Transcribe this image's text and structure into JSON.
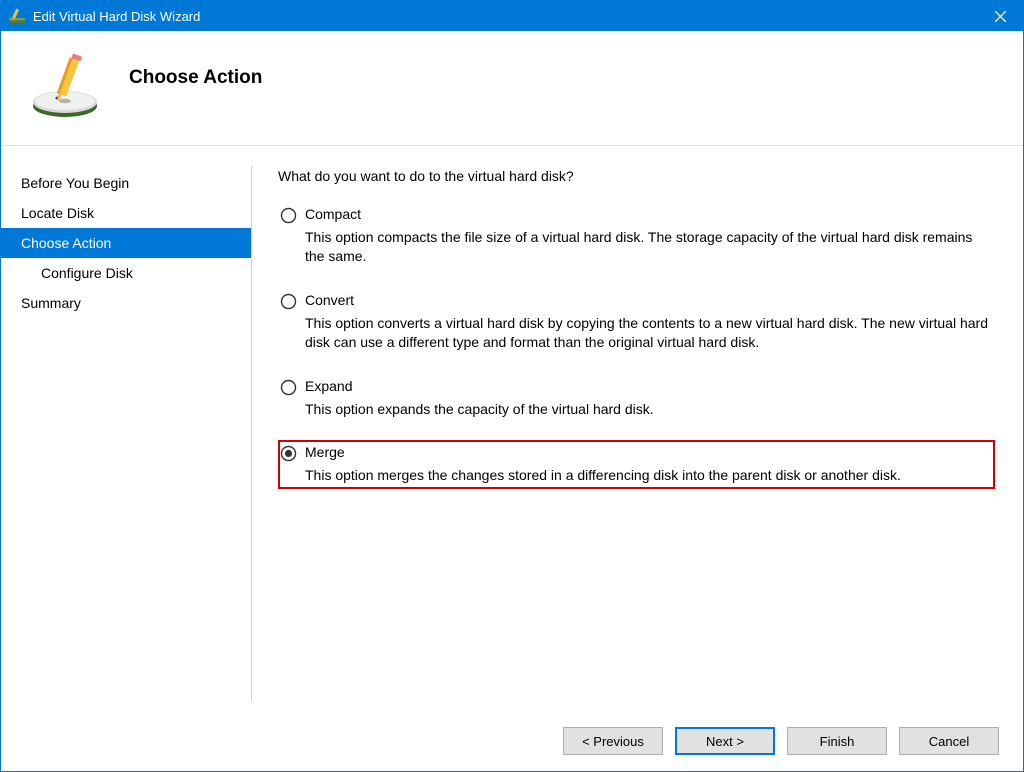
{
  "titlebar": {
    "title": "Edit Virtual Hard Disk Wizard"
  },
  "header": {
    "title": "Choose Action"
  },
  "sidebar": {
    "items": [
      {
        "label": "Before You Begin",
        "active": false,
        "child": false
      },
      {
        "label": "Locate Disk",
        "active": false,
        "child": false
      },
      {
        "label": "Choose Action",
        "active": true,
        "child": false
      },
      {
        "label": "Configure Disk",
        "active": false,
        "child": true
      },
      {
        "label": "Summary",
        "active": false,
        "child": false
      }
    ]
  },
  "content": {
    "prompt": "What do you want to do to the virtual hard disk?",
    "options": [
      {
        "label": "Compact",
        "desc": "This option compacts the file size of a virtual hard disk. The storage capacity of the virtual hard disk remains the same.",
        "selected": false
      },
      {
        "label": "Convert",
        "desc": "This option converts a virtual hard disk by copying the contents to a new virtual hard disk. The new virtual hard disk can use a different type and format than the original virtual hard disk.",
        "selected": false
      },
      {
        "label": "Expand",
        "desc": "This option expands the capacity of the virtual hard disk.",
        "selected": false
      },
      {
        "label": "Merge",
        "desc": "This option merges the changes stored in a differencing disk into the parent disk or another disk.",
        "selected": true,
        "highlighted": true
      }
    ]
  },
  "footer": {
    "previous": "< Previous",
    "next": "Next >",
    "finish": "Finish",
    "cancel": "Cancel"
  }
}
